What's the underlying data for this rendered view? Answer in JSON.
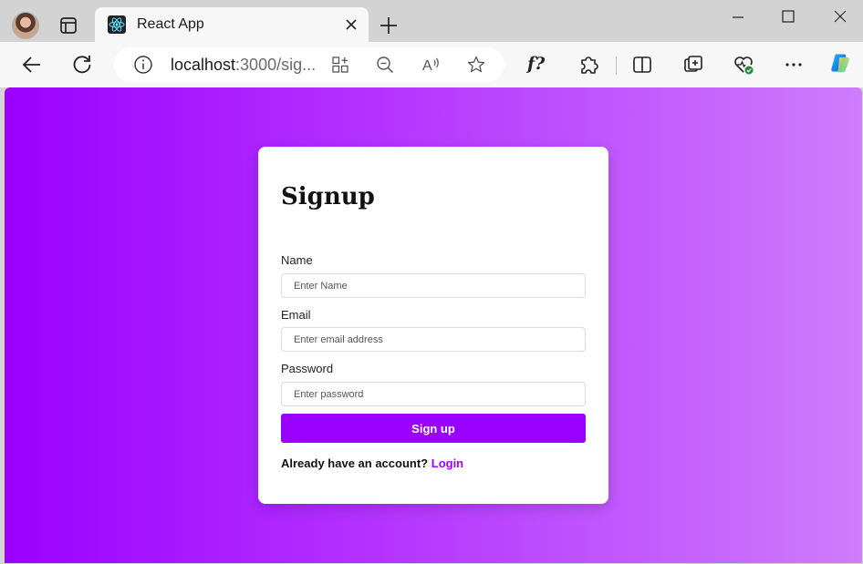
{
  "browser": {
    "tab_title": "React App",
    "url_host": "localhost",
    "url_rest": ":3000/sig...",
    "read_aloud_glyph": "A",
    "formula_label": "f?",
    "icons": [
      "profile-avatar",
      "tab-actions-icon",
      "react-favicon",
      "close-icon",
      "plus-icon",
      "minimize-icon",
      "maximize-icon",
      "close-window-icon",
      "back-arrow-icon",
      "refresh-icon",
      "info-icon",
      "app-available-icon",
      "zoom-out-icon",
      "read-aloud-icon",
      "favorite-star-icon",
      "extensions-icon",
      "split-screen-icon",
      "collections-icon",
      "browser-essentials-icon",
      "more-icon",
      "copilot-icon"
    ]
  },
  "page": {
    "background_gradient": [
      "#9b00ff",
      "#ce7dfc"
    ],
    "accent": "#9900ff",
    "heading": "Signup",
    "fields": {
      "name": {
        "label": "Name",
        "placeholder": "Enter Name",
        "value": ""
      },
      "email": {
        "label": "Email",
        "placeholder": "Enter email address",
        "value": ""
      },
      "password": {
        "label": "Password",
        "placeholder": "Enter password",
        "value": ""
      }
    },
    "submit_label": "Sign up",
    "footer_prompt": "Already have an account?",
    "footer_link": "Login"
  }
}
